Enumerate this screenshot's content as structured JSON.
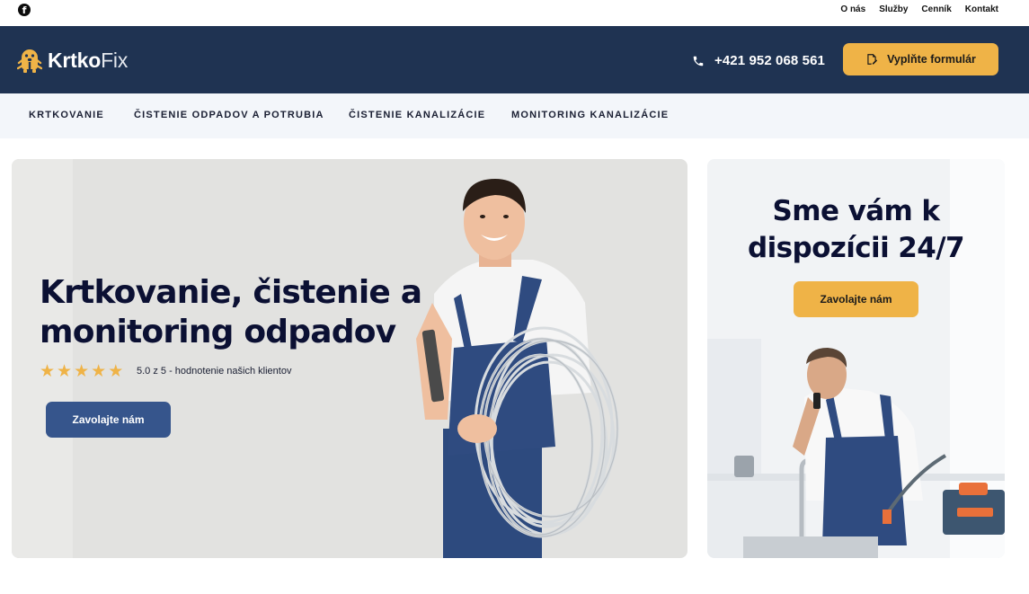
{
  "topbar": {
    "social_icon": "facebook-icon",
    "links": [
      "O nás",
      "Služby",
      "Cenník",
      "Kontakt"
    ]
  },
  "header": {
    "logo_bold": "Krtko",
    "logo_light": "Fix",
    "phone": "+421 952 068 561",
    "form_button": "Vyplňte formulár"
  },
  "nav": {
    "items": [
      "KRTKOVANIE",
      "ČISTENIE ODPADOV A POTRUBIA",
      "ČISTENIE KANALIZÁCIE",
      "MONITORING KANALIZÁCIE"
    ]
  },
  "hero": {
    "title": "Krtkovanie, čistenie a monitoring odpadov",
    "stars": 5,
    "rating_text": "5.0 z 5 - hodnotenie našich klientov",
    "button": "Zavolajte nám"
  },
  "side": {
    "title": "Sme vám k dispozícii 24/7",
    "button": "Zavolajte nám"
  },
  "colors": {
    "header_bg": "#1f3352",
    "accent_yellow": "#efb347",
    "primary_blue": "#36558c",
    "nav_bg": "#f3f6fa",
    "heading": "#0b1033"
  }
}
